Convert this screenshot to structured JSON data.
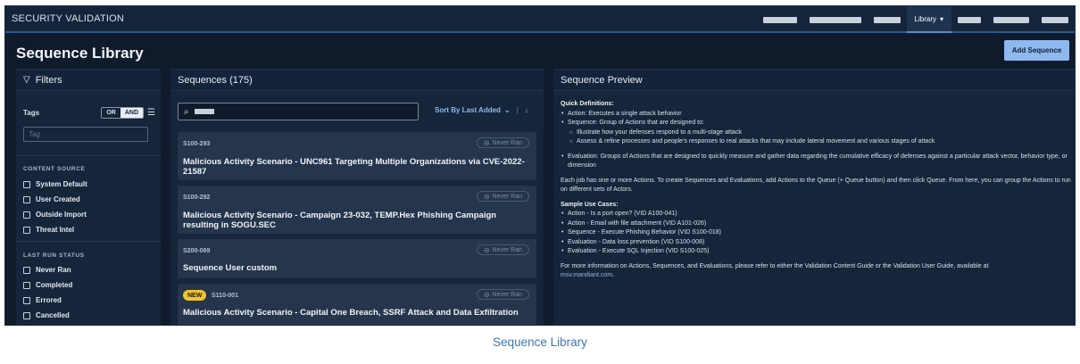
{
  "app": {
    "title": "SECURITY VALIDATION",
    "nav": {
      "active_label": "Library"
    }
  },
  "page": {
    "title": "Sequence Library",
    "add_button": "Add Sequence",
    "caption": "Sequence Library"
  },
  "filters": {
    "heading": "Filters",
    "tags_label": "Tags",
    "or_label": "OR",
    "and_label": "AND",
    "tag_placeholder": "Tag",
    "content_source_title": "CONTENT SOURCE",
    "content_source": [
      "System Default",
      "User Created",
      "Outside Import",
      "Threat Intel"
    ],
    "last_run_title": "LAST RUN STATUS",
    "last_run": [
      "Never Ran",
      "Completed",
      "Errored",
      "Cancelled"
    ]
  },
  "sequences": {
    "heading": "Sequences (175)",
    "sort_label": "Sort By Last Added",
    "items": [
      {
        "id": "S100-293",
        "status": "Never Ran",
        "title": "Malicious Activity Scenario - UNC961 Targeting Multiple Organizations via CVE-2022-21587"
      },
      {
        "id": "S100-292",
        "status": "Never Ran",
        "title": "Malicious Activity Scenario - Campaign 23-032, TEMP.Hex Phishing Campaign resulting in SOGU.SEC"
      },
      {
        "id": "S200-069",
        "status": "Never Ran",
        "title": "Sequence User custom"
      },
      {
        "id": "S110-001",
        "status": "Never Ran",
        "badge": "NEW",
        "title": "Malicious Activity Scenario - Capital One Breach, SSRF Attack and Data Exfiltration"
      }
    ]
  },
  "preview": {
    "heading": "Sequence Preview",
    "quick_title": "Quick Definitions:",
    "action_def": "Action: Executes a single attack behavior",
    "sequence_def": "Sequence: Group of Actions that are designed to:",
    "sequence_sub1": "Illustrate how your defenses respond to a multi-stage attack",
    "sequence_sub2": "Assess & refine processes and people's responses to real attacks that may include lateral movement and various stages of attack",
    "evaluation_def": "Evaluation: Groups of Actions that are designed to quickly measure and gather data regarding the cumulative efficacy of defenses against a particular attack vector, behavior type, or dimension",
    "jobs_text": "Each job has one or more Actions. To create Sequences and Evaluations, add Actions to the Queue (+ Queue button) and then click Queue. From here, you can group the Actions to run on different sets of Actors.",
    "use_cases_title": "Sample Use Cases:",
    "use_cases": [
      "Action - Is a port open? (VID A100-041)",
      "Action - Email with file attachment (VID A101-026)",
      "Sequence - Execute Phishing Behavior (VID S100-018)",
      "Evaluation - Data loss prevention (VID S100-008)",
      "Evaluation - Execute SQL Injection (VID S100-025)"
    ],
    "more_info": "For more information on Actions, Sequences, and Evaluations, please refer to either the Validation Content Guide or the Validation User Guide, available at",
    "link": "msv.mandiant.com",
    "link_tail": "."
  }
}
